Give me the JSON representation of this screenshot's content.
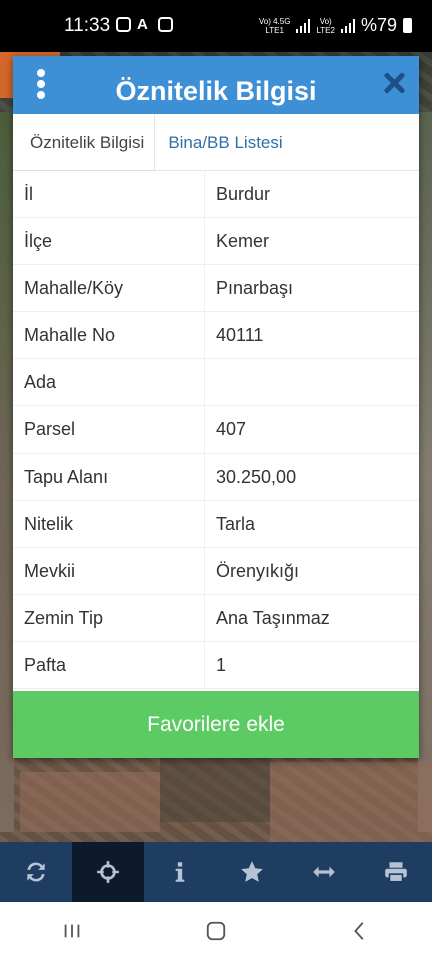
{
  "status_bar": {
    "time": "11:33",
    "net1": "Vo) 4.5G\nLTE1",
    "net2": "Vo)\nLTE2",
    "battery": "%79"
  },
  "dialog": {
    "title": "Öznitelik Bilgisi",
    "tabs": [
      {
        "label": "Öznitelik Bilgisi",
        "active": true
      },
      {
        "label": "Bina/BB Listesi",
        "active": false
      }
    ],
    "rows": [
      {
        "key": "İl",
        "value": "Burdur"
      },
      {
        "key": "İlçe",
        "value": "Kemer"
      },
      {
        "key": "Mahalle/Köy",
        "value": "Pınarbaşı"
      },
      {
        "key": "Mahalle No",
        "value": "40111"
      },
      {
        "key": "Ada",
        "value": ""
      },
      {
        "key": "Parsel",
        "value": "407"
      },
      {
        "key": "Tapu Alanı",
        "value": "30.250,00"
      },
      {
        "key": "Nitelik",
        "value": "Tarla"
      },
      {
        "key": "Mevkii",
        "value": "Örenyıkığı"
      },
      {
        "key": "Zemin Tip",
        "value": "Ana Taşınmaz"
      },
      {
        "key": "Pafta",
        "value": "1"
      }
    ],
    "favorite_button": "Favorilere ekle"
  },
  "toolbar": {
    "items": [
      "refresh-icon",
      "crosshair-icon",
      "info-icon",
      "star-icon",
      "measure-icon",
      "print-icon"
    ],
    "active_index": 1
  },
  "colors": {
    "header": "#3d8fd6",
    "button": "#5ccb64",
    "toolbar": "#1f3d60",
    "tab_link": "#2f6faa"
  }
}
